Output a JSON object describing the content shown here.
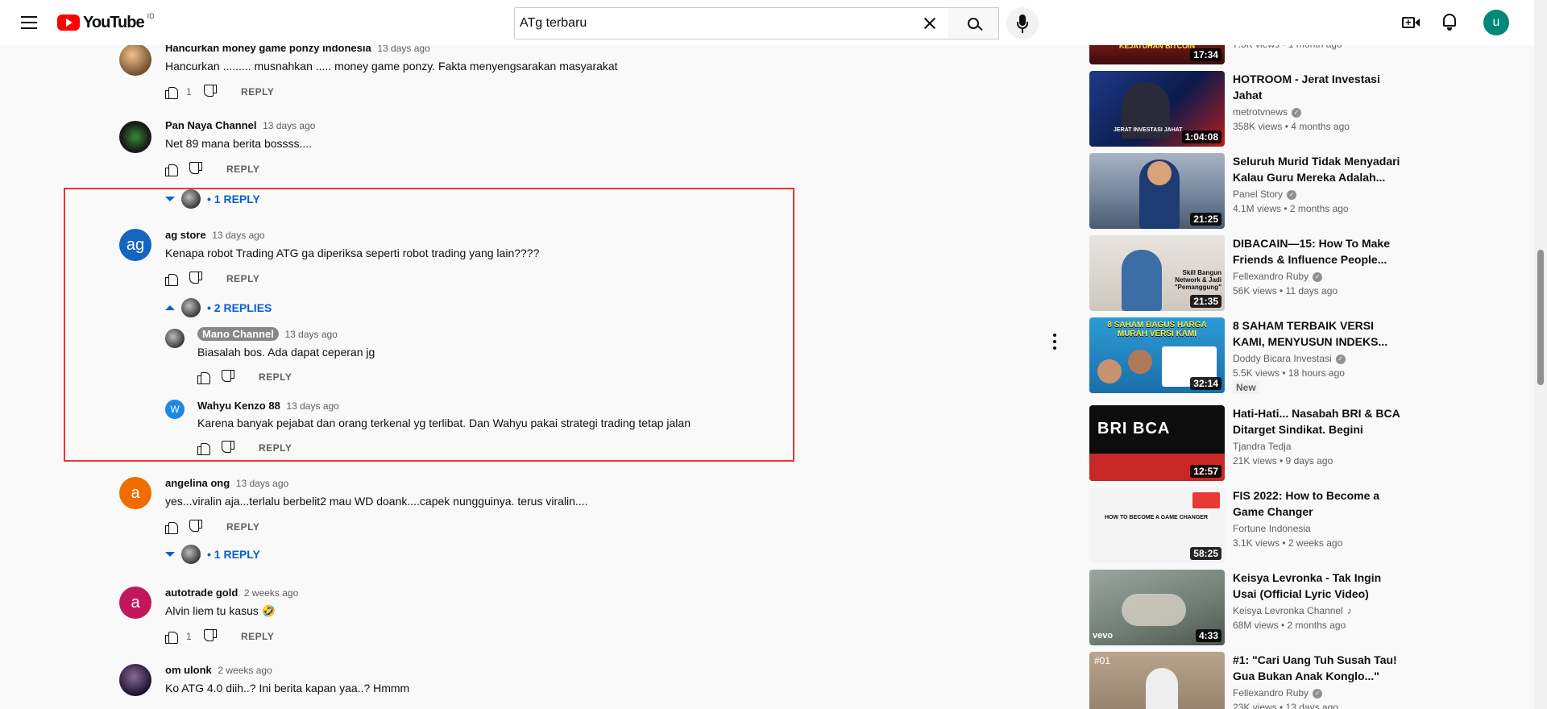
{
  "header": {
    "logo_text": "YouTube",
    "region": "ID",
    "search": {
      "value": "ATg terbaru",
      "placeholder": "Search"
    },
    "user_initial": "u"
  },
  "comments": [
    {
      "author": "Hancurkan money game ponzy indonesia",
      "time": "13 days ago",
      "text": "Hancurkan ......... musnahkan  ..... money game ponzy. Fakta menyengsarakan masyarakat",
      "likes": "1",
      "reply_label": "REPLY"
    },
    {
      "author": "Pan Naya Channel",
      "time": "13 days ago",
      "text": "Net 89 mana berita bossss....",
      "likes": "",
      "reply_label": "REPLY",
      "replies_toggle": "1 REPLY"
    },
    {
      "author": "ag store",
      "avatar_text": "ag",
      "time": "13 days ago",
      "text": "Kenapa robot Trading ATG ga diperiksa seperti robot trading yang lain????",
      "likes": "",
      "reply_label": "REPLY",
      "replies_toggle": "2 REPLIES",
      "replies": [
        {
          "author": "Mano Channel",
          "time": "13 days ago",
          "text": "Biasalah bos. Ada dapat ceperan jg",
          "reply_label": "REPLY"
        },
        {
          "author": "Wahyu Kenzo 88",
          "avatar_text": "W",
          "time": "13 days ago",
          "text": "Karena banyak pejabat dan orang terkenal yg terlibat. Dan Wahyu pakai strategi trading tetap jalan",
          "reply_label": "REPLY"
        }
      ]
    },
    {
      "author": "angelina ong",
      "avatar_text": "a",
      "time": "13 days ago",
      "text": "yes...viralin aja...terlalu berbelit2 mau WD doank....capek nungguinya. terus viralin....",
      "likes": "",
      "reply_label": "REPLY",
      "replies_toggle": "1 REPLY"
    },
    {
      "author": "autotrade gold",
      "avatar_text": "a",
      "time": "2 weeks ago",
      "text": "Alvin liem tu kasus 🤣",
      "likes": "1",
      "reply_label": "REPLY"
    },
    {
      "author": "om ulonk",
      "time": "2 weeks ago",
      "text": "Ko ATG 4.0 diih..? Ini berita kapan yaa..? Hmmm"
    }
  ],
  "sidebar": [
    {
      "title": "",
      "channel": "",
      "meta": "7.5K views • 1 month ago",
      "duration": "17:34",
      "thumb_caption": "EL SAVADOR SEKARAT KEJATUHAN BITCOIN"
    },
    {
      "title": "HOTROOM - Jerat Investasi Jahat",
      "channel": "metrotvnews",
      "meta": "358K views • 4 months ago",
      "duration": "1:04:08",
      "thumb_caption": "JERAT INVESTASI JAHAT"
    },
    {
      "title": "Seluruh Murid Tidak Menyadari Kalau Guru Mereka Adalah...",
      "channel": "Panel Story",
      "meta": "4.1M views • 2 months ago",
      "duration": "21:25"
    },
    {
      "title": "DIBACAIN—15: How To Make Friends & Influence People...",
      "channel": "Fellexandro Ruby",
      "meta": "56K views • 11 days ago",
      "duration": "21:35",
      "thumb_caption": "Skill Bangun Network & Jadi \"Pemanggung\""
    },
    {
      "title": "8 SAHAM TERBAIK VERSI KAMI, MENYUSUN INDEKS...",
      "channel": "Doddy Bicara Investasi",
      "meta": "5.5K views • 18 hours ago",
      "duration": "32:14",
      "badge": "New",
      "thumb_caption": "8 SAHAM BAGUS HARGA MURAH VERSI KAMI"
    },
    {
      "title": "Hati-Hati... Nasabah BRI & BCA Ditarget Sindikat. Begini Modu...",
      "channel": "Tjandra Tedja",
      "meta": "21K views • 9 days ago",
      "duration": "12:57",
      "thumb_caption": "BRI BCA"
    },
    {
      "title": "FIS 2022: How to Become a Game Changer",
      "channel": "Fortune Indonesia",
      "meta": "3.1K views • 2 weeks ago",
      "duration": "58:25",
      "thumb_caption": "HOW TO BECOME A GAME CHANGER"
    },
    {
      "title": "Keisya Levronka - Tak Ingin Usai (Official Lyric Video)",
      "channel": "Keisya Levronka Channel",
      "meta": "68M views • 2 months ago",
      "duration": "4:33",
      "thumb_caption": "vevo"
    },
    {
      "title": "#1: \"Cari Uang Tuh Susah Tau! Gua Bukan Anak Konglo...\"",
      "channel": "Fellexandro Ruby",
      "meta": "23K views • 13 days ago",
      "duration": "",
      "thumb_caption": "#01"
    }
  ],
  "colors": {
    "accent": "#065fd4",
    "highlight": "#e53935",
    "brand": "#ff0000"
  }
}
